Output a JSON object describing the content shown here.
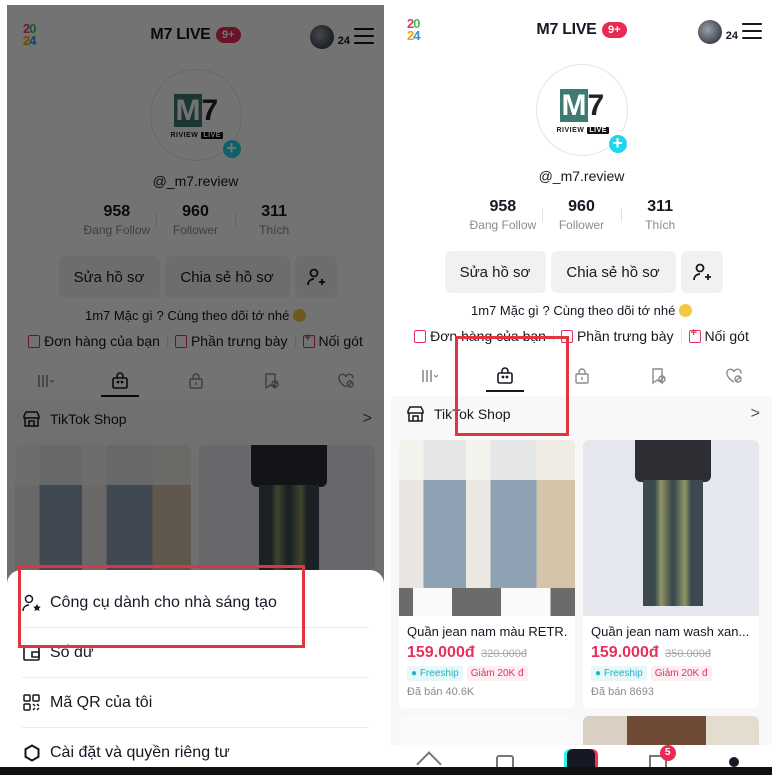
{
  "header": {
    "logo_text_top": "20",
    "logo_text_bottom": "24",
    "title": "M7 LIVE",
    "notification_badge": "9+",
    "avatar_count": "24"
  },
  "profile": {
    "avatar_top": "M7",
    "avatar_sub": "RIVIEW",
    "avatar_live": "LIVE",
    "username": "@_m7.review",
    "stats": [
      {
        "value": "958",
        "label": "Đang Follow"
      },
      {
        "value": "960",
        "label": "Follower"
      },
      {
        "value": "311",
        "label": "Thích"
      }
    ],
    "edit_button": "Sửa hồ sơ",
    "share_button": "Chia sẻ hồ sơ",
    "bio": "1m7 Mặc gì ? Cùng theo dõi tớ nhé"
  },
  "shortcuts": [
    {
      "label": "Đơn hàng của bạn",
      "icon": "order-bag-icon"
    },
    {
      "label": "Phần trưng bày",
      "icon": "showcase-bag-icon"
    },
    {
      "label": "Nối gót",
      "icon": "add-box-icon"
    }
  ],
  "tabs": [
    {
      "icon": "grid-icon",
      "active": false
    },
    {
      "icon": "shopping-bag-icon",
      "active": true
    },
    {
      "icon": "lock-icon",
      "active": false
    },
    {
      "icon": "bookmark-hidden-icon",
      "active": false
    },
    {
      "icon": "heart-hidden-icon",
      "active": false
    }
  ],
  "shop": {
    "label": "TikTok Shop",
    "chevron": ">"
  },
  "products": [
    {
      "title": "Quần jean nam màu RETR...",
      "price": "159.000đ",
      "original_price": "320.000đ",
      "tag_freeship": "Freeship",
      "tag_discount": "Giảm 20K đ",
      "sold": "Đã bán 40.6K"
    },
    {
      "title": "Quần jean nam wash xan...",
      "price": "159.000đ",
      "original_price": "350.000đ",
      "tag_freeship": "Freeship",
      "tag_discount": "Giảm 20K đ",
      "sold": "Đã bán 8693"
    }
  ],
  "bottom_nav": {
    "inbox_badge": "5"
  },
  "sheet": {
    "items": [
      {
        "label": "Công cụ dành cho nhà sáng tạo",
        "icon": "creator-tools-icon"
      },
      {
        "label": "Số dư",
        "icon": "wallet-icon"
      },
      {
        "label": "Mã QR của tôi",
        "icon": "qr-code-icon"
      },
      {
        "label": "Cài đặt và quyền riêng tư",
        "icon": "settings-gear-icon"
      }
    ]
  },
  "colors": {
    "accent_red": "#e6315e",
    "highlight_box": "#e0343f",
    "tiktok_cyan": "#20d5ec"
  }
}
